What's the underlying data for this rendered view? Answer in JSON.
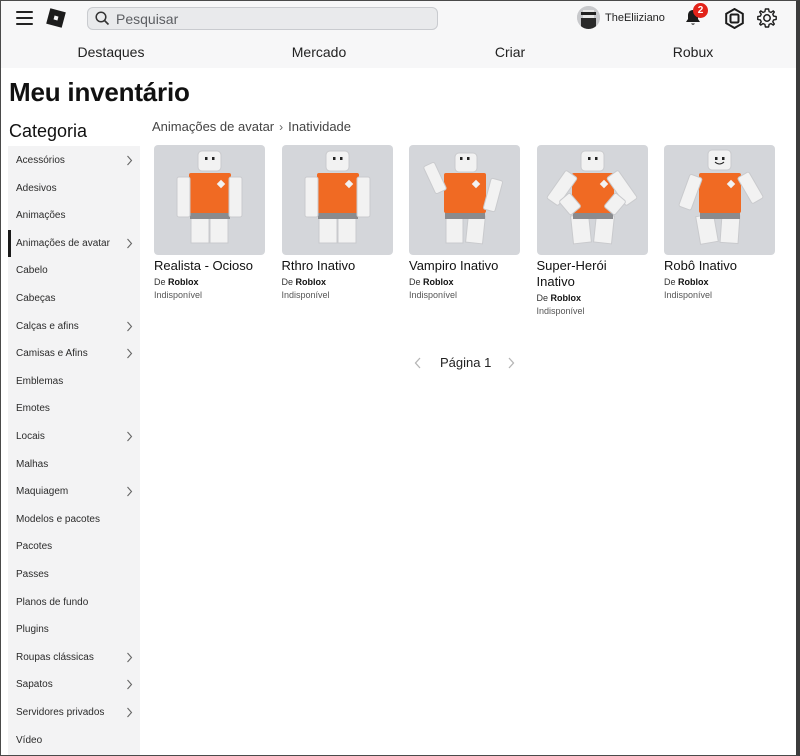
{
  "search": {
    "placeholder": "Pesquisar"
  },
  "user": {
    "name": "TheEliiziano"
  },
  "notifications": {
    "count": "2"
  },
  "nav": {
    "items": [
      "Destaques",
      "Mercado",
      "Criar",
      "Robux"
    ]
  },
  "page": {
    "title": "Meu inventário"
  },
  "sidebar": {
    "title": "Categoria",
    "items": [
      {
        "label": "Acessórios",
        "chevron": true
      },
      {
        "label": "Adesivos",
        "chevron": false
      },
      {
        "label": "Animações",
        "chevron": false
      },
      {
        "label": "Animações de avatar",
        "chevron": true,
        "active": true
      },
      {
        "label": "Cabelo",
        "chevron": false
      },
      {
        "label": "Cabeças",
        "chevron": false
      },
      {
        "label": "Calças e afins",
        "chevron": true
      },
      {
        "label": "Camisas e Afins",
        "chevron": true
      },
      {
        "label": "Emblemas",
        "chevron": false
      },
      {
        "label": "Emotes",
        "chevron": false
      },
      {
        "label": "Locais",
        "chevron": true
      },
      {
        "label": "Malhas",
        "chevron": false
      },
      {
        "label": "Maquiagem",
        "chevron": true
      },
      {
        "label": "Modelos e pacotes",
        "chevron": false
      },
      {
        "label": "Pacotes",
        "chevron": false
      },
      {
        "label": "Passes",
        "chevron": false
      },
      {
        "label": "Planos de fundo",
        "chevron": false
      },
      {
        "label": "Plugins",
        "chevron": false
      },
      {
        "label": "Roupas clássicas",
        "chevron": true
      },
      {
        "label": "Sapatos",
        "chevron": true
      },
      {
        "label": "Servidores privados",
        "chevron": true
      },
      {
        "label": "Vídeo",
        "chevron": false
      }
    ]
  },
  "breadcrumb": {
    "parent": "Animações de avatar",
    "current": "Inatividade"
  },
  "items": [
    {
      "name": "Realista - Ocioso",
      "creator_prefix": "De",
      "creator": "Roblox",
      "status": "Indisponível",
      "pose": "idle"
    },
    {
      "name": "Rthro Inativo",
      "creator_prefix": "De",
      "creator": "Roblox",
      "status": "Indisponível",
      "pose": "idle"
    },
    {
      "name": "Vampiro Inativo",
      "creator_prefix": "De",
      "creator": "Roblox",
      "status": "Indisponível",
      "pose": "vampire"
    },
    {
      "name": "Super-Herói Inativo",
      "creator_prefix": "De",
      "creator": "Roblox",
      "status": "Indisponível",
      "pose": "hero"
    },
    {
      "name": "Robô Inativo",
      "creator_prefix": "De",
      "creator": "Roblox",
      "status": "Indisponível",
      "pose": "robot"
    }
  ],
  "pagination": {
    "label": "Página 1"
  },
  "colors": {
    "shirt": "#f06a23",
    "skin": "#f2f2f2",
    "badge": "#e2231a",
    "thumb_bg": "#d4d6da"
  }
}
